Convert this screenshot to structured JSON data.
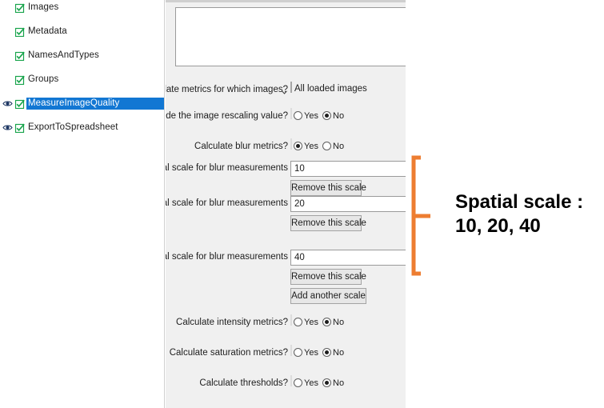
{
  "sidebar": {
    "modules": [
      {
        "label": "Images",
        "eye": false,
        "checked": true,
        "selected": false
      },
      {
        "label": "Metadata",
        "eye": false,
        "checked": true,
        "selected": false
      },
      {
        "label": "NamesAndTypes",
        "eye": false,
        "checked": true,
        "selected": false
      },
      {
        "label": "Groups",
        "eye": false,
        "checked": true,
        "selected": false
      },
      {
        "label": "MeasureImageQuality",
        "eye": true,
        "checked": true,
        "selected": true
      },
      {
        "label": "ExportToSpreadsheet",
        "eye": true,
        "checked": true,
        "selected": false
      }
    ],
    "icons": {
      "eye": "eye-icon",
      "check": "checkbox-checked-icon"
    }
  },
  "panel": {
    "notes": {
      "value": "",
      "placeholder": ""
    },
    "settings": [
      {
        "id": "calculate-metrics-for-which-images",
        "label": "Calculate metrics for which images?",
        "type": "dropdown",
        "value": "All loaded images",
        "options": [
          "All loaded images"
        ]
      },
      {
        "id": "include-image-rescaling-value",
        "label": "Include the image rescaling value?",
        "type": "radio",
        "value": "No",
        "yes_label": "Yes",
        "no_label": "No"
      },
      {
        "id": "calculate-blur-metrics",
        "label": "Calculate blur metrics?",
        "type": "radio",
        "value": "Yes",
        "yes_label": "Yes",
        "no_label": "No"
      },
      {
        "id": "spatial-scale-1",
        "label": "Spatial scale for blur measurements",
        "type": "text",
        "value": "10"
      },
      {
        "id": "spatial-scale-2",
        "label": "Spatial scale for blur measurements",
        "type": "text",
        "value": "20"
      },
      {
        "id": "spatial-scale-3",
        "label": "Spatial scale for blur measurements",
        "type": "text",
        "value": "40"
      },
      {
        "id": "calculate-intensity-metrics",
        "label": "Calculate intensity metrics?",
        "type": "radio",
        "value": "No",
        "yes_label": "Yes",
        "no_label": "No"
      },
      {
        "id": "calculate-saturation-metrics",
        "label": "Calculate saturation metrics?",
        "type": "radio",
        "value": "No",
        "yes_label": "Yes",
        "no_label": "No"
      },
      {
        "id": "calculate-thresholds",
        "label": "Calculate thresholds?",
        "type": "radio",
        "value": "No",
        "yes_label": "Yes",
        "no_label": "No"
      }
    ],
    "buttons": {
      "remove_scale_1": "Remove this scale",
      "remove_scale_2": "Remove this scale",
      "remove_scale_3": "Remove this scale",
      "add_scale": "Add another scale"
    }
  },
  "annotation": {
    "line1": "Spatial scale :",
    "line2": "10, 20, 40",
    "brace_color": "#ED7D31",
    "text_color": "#000000"
  },
  "colors": {
    "selection_blue": "#1277d3",
    "panel_gray": "#f0f0f0",
    "accent_orange": "#ED7D31",
    "check_green": "#16a34a"
  }
}
